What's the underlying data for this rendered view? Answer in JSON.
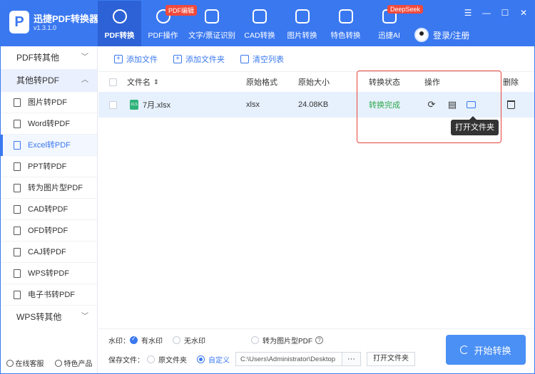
{
  "app": {
    "logo_letter": "P",
    "name": "迅捷PDF转换器",
    "version": "v1.3.1.0"
  },
  "nav": [
    {
      "label": "PDF转换",
      "badge": ""
    },
    {
      "label": "PDF操作",
      "badge": "PDF编辑"
    },
    {
      "label": "文字/票证识别",
      "badge": ""
    },
    {
      "label": "CAD转换",
      "badge": ""
    },
    {
      "label": "图片转换",
      "badge": ""
    },
    {
      "label": "特色转换",
      "badge": ""
    },
    {
      "label": "迅捷AI",
      "badge": "DeepSeek"
    }
  ],
  "user": {
    "login_label": "登录/注册"
  },
  "window": {
    "menu": "☰",
    "minimize": "—",
    "maximize": "☐",
    "close": "✕"
  },
  "sidebar": {
    "group_pdf_to_other": "PDF转其他",
    "group_other_to_pdf": "其他转PDF",
    "items": [
      "图片转PDF",
      "Word转PDF",
      "Excel转PDF",
      "PPT转PDF",
      "转为图片型PDF",
      "CAD转PDF",
      "OFD转PDF",
      "CAJ转PDF",
      "WPS转PDF",
      "电子书转PDF"
    ],
    "group_wps_to_other": "WPS转其他",
    "support": "在线客服",
    "featured": "特色产品"
  },
  "toolbar": {
    "add_file": "添加文件",
    "add_folder": "添加文件夹",
    "clear_list": "清空列表"
  },
  "table": {
    "headers": {
      "filename": "文件名",
      "sort": "⇕",
      "format": "原始格式",
      "size": "原始大小",
      "status": "转换状态",
      "ops": "操作",
      "delete": "删除"
    },
    "rows": [
      {
        "filename": "7月.xlsx",
        "icon_text": "XLS",
        "format": "xlsx",
        "size": "24.08KB",
        "status": "转换完成"
      }
    ]
  },
  "tooltip": "打开文件夹",
  "footer": {
    "watermark_label": "水印：",
    "with_watermark": "有水印",
    "no_watermark": "无水印",
    "to_image_pdf": "转为图片型PDF",
    "help": "?",
    "save_label": "保存文件：",
    "original_folder": "原文件夹",
    "custom": "自定义",
    "path": "C:\\Users\\Administrator\\Desktop",
    "dots": "···",
    "open_folder": "打开文件夹",
    "start": "开始转换"
  },
  "colors": {
    "brand": "#3a78f0",
    "success": "#2ea84a",
    "highlight": "#e8453b"
  }
}
